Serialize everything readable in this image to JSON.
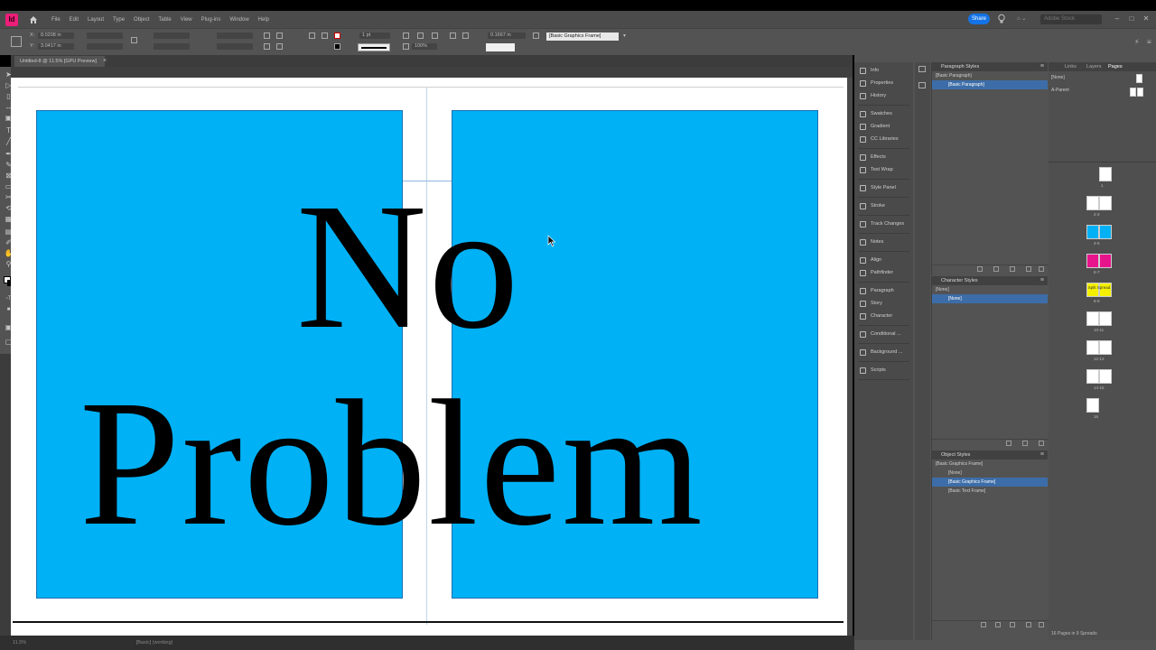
{
  "menu": {
    "logo": "Id",
    "items": [
      "File",
      "Edit",
      "Layout",
      "Type",
      "Object",
      "Table",
      "View",
      "Plug-ins",
      "Window",
      "Help"
    ],
    "share": "Share",
    "search_placeholder": "Adobe Stock"
  },
  "control": {
    "x_label": "X:",
    "x_value": "8.0208 in",
    "y_label": "Y:",
    "y_value": "3.0417 in",
    "stroke_weight": "1 pt",
    "opacity": "100%",
    "effect_value": "0.1667 in",
    "object_style": "[Basic Graphics Frame]"
  },
  "document": {
    "tab_title": "Untitled-8 @ 11.5% [GPU Preview]",
    "headline_line1": "No",
    "headline_line2": "Problem",
    "page_color": "#00b1f5"
  },
  "status": {
    "zoom": "11.5%",
    "errors": "[Basic] (working)"
  },
  "dock": {
    "groups": [
      [
        "Info",
        "Properties",
        "History"
      ],
      [
        "Swatches",
        "Gradient",
        "CC Libraries"
      ],
      [
        "Effects",
        "Text Wrap"
      ],
      [
        "Style Panel"
      ],
      [
        "Stroke"
      ],
      [
        "Track Changes"
      ],
      [
        "Notes"
      ],
      [
        "Align",
        "Pathfinder"
      ],
      [
        "Paragraph",
        "Story",
        "Character"
      ],
      [
        "Conditional ..."
      ],
      [
        "Background ..."
      ],
      [
        "Scripts"
      ]
    ]
  },
  "paragraph_styles": {
    "title": "Paragraph Styles",
    "current": "[Basic Paragraph]",
    "rows": [
      {
        "label": "[Basic Paragraph]",
        "selected": true
      }
    ]
  },
  "character_styles": {
    "title": "Character Styles",
    "current": "[None]",
    "rows": [
      {
        "label": "[None]",
        "selected": true
      }
    ]
  },
  "object_styles": {
    "title": "Object Styles",
    "current": "[Basic Graphics Frame]",
    "rows": [
      {
        "label": "[None]",
        "selected": false
      },
      {
        "label": "[Basic Graphics Frame]",
        "selected": true
      },
      {
        "label": "[Basic Text Frame]",
        "selected": false
      }
    ]
  },
  "pages": {
    "tabs": [
      "Links",
      "Layers",
      "Pages"
    ],
    "active_tab": "Pages",
    "master_none": "[None]",
    "master_a": "A-Parent",
    "spreads": [
      {
        "label": "1",
        "pages": 1,
        "color": "#ffffff"
      },
      {
        "label": "2-3",
        "pages": 2,
        "color": "#ffffff"
      },
      {
        "label": "4-5",
        "pages": 2,
        "color": "#00b1f5"
      },
      {
        "label": "6-7",
        "pages": 2,
        "color": "#e8148c"
      },
      {
        "label": "8-9",
        "pages": 2,
        "color": "#f5f000",
        "text": "Split Spread"
      },
      {
        "label": "10-11",
        "pages": 2,
        "color": "#ffffff"
      },
      {
        "label": "12-13",
        "pages": 2,
        "color": "#ffffff"
      },
      {
        "label": "14-15",
        "pages": 2,
        "color": "#ffffff"
      },
      {
        "label": "16",
        "pages": 1,
        "color": "#ffffff"
      }
    ],
    "footer": "16 Pages in 9 Spreads"
  }
}
